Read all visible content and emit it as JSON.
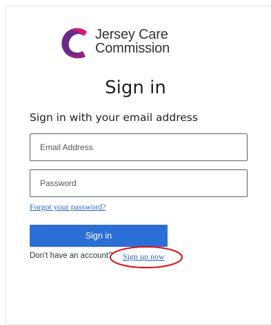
{
  "brand": {
    "name_line1": "Jersey Care",
    "name_line2": "Commission",
    "logo_colors": [
      "#6b2a86",
      "#e0167a"
    ]
  },
  "page": {
    "title": "Sign in",
    "subtitle": "Sign in with your email address"
  },
  "form": {
    "email_placeholder": "Email Address",
    "password_placeholder": "Password",
    "email_value": "",
    "password_value": "",
    "forgot_label": "Forgot your password?",
    "submit_label": "Sign in"
  },
  "footer": {
    "no_account_text": "Don't have an account?",
    "signup_label": "Sign up now"
  },
  "annotation": {
    "ring_color": "#e01010",
    "ring_icon": "ellipse-highlight"
  },
  "colors": {
    "accent": "#2b6fd6",
    "link": "#2d63c8"
  }
}
